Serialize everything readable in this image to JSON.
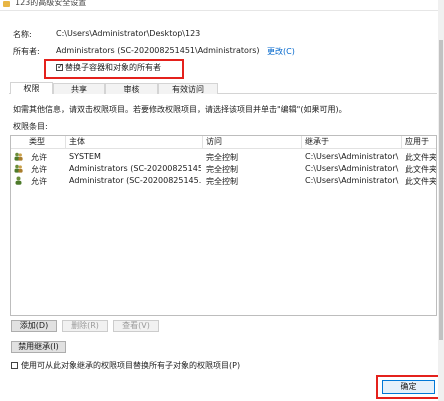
{
  "window": {
    "title": "123的高级安全设置"
  },
  "info": {
    "name_label": "名称:",
    "name_value": "C:\\Users\\Administrator\\Desktop\\123",
    "owner_label": "所有者:",
    "owner_value": "Administrators (SC-202008251451\\Administrators)",
    "change_link": "更改(C)",
    "replace_owner_label": "替换子容器和对象的所有者",
    "replace_owner_checked": true
  },
  "tabs": [
    {
      "label": "权限",
      "active": true
    },
    {
      "label": "共享",
      "active": false
    },
    {
      "label": "审核",
      "active": false
    },
    {
      "label": "有效访问",
      "active": false
    }
  ],
  "hint": "如需其他信息，请双击权限项目。若要修改权限项目，请选择该项目并单击\"编辑\"(如果可用)。",
  "entries_label": "权限条目:",
  "columns": [
    "类型",
    "主体",
    "访问",
    "继承于",
    "应用于"
  ],
  "rows": [
    {
      "icon": "user-group-icon",
      "type": "允许",
      "principal": "SYSTEM",
      "access": "完全控制",
      "inherited": "C:\\Users\\Administrator\\",
      "applies": "此文件夹、子"
    },
    {
      "icon": "user-group-icon",
      "type": "允许",
      "principal": "Administrators (SC-20200825145...",
      "access": "完全控制",
      "inherited": "C:\\Users\\Administrator\\",
      "applies": "此文件夹、子"
    },
    {
      "icon": "user-icon",
      "type": "允许",
      "principal": "Administrator (SC-20200825145...",
      "access": "完全控制",
      "inherited": "C:\\Users\\Administrator\\",
      "applies": "此文件夹、子"
    }
  ],
  "buttons": {
    "add": "添加(D)",
    "remove": "删除(R)",
    "view": "查看(V)",
    "disable_inheritance": "禁用继承(I)",
    "ok": "确定"
  },
  "replace_child_label": "使用可从此对象继承的权限项目替换所有子对象的权限项目(P)",
  "replace_child_checked": false,
  "colors": {
    "highlight": "#e4211c",
    "link": "#0066cc"
  }
}
